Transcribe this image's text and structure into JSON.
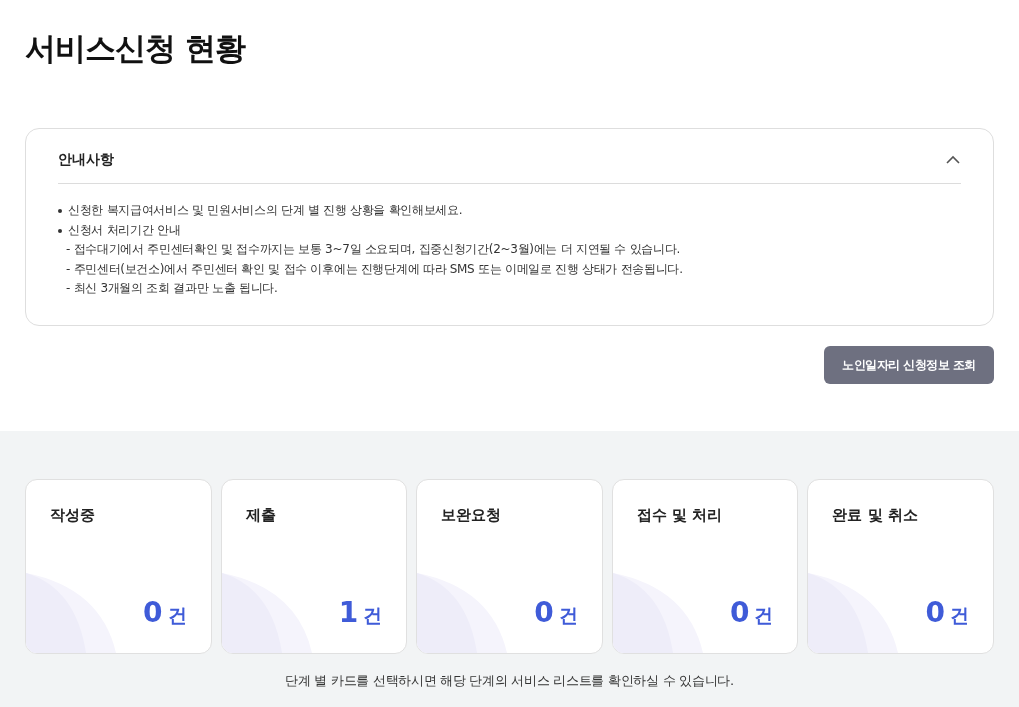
{
  "page_title": "서비스신청 현황",
  "notice": {
    "title": "안내사항",
    "expanded": true,
    "items": [
      {
        "text": "신청한 복지급여서비스 및 민원서비스의 단계 별 진행 상황을 확인해보세요."
      },
      {
        "text": "신청서 처리기간 안내",
        "children": [
          "- 접수대기에서 주민센터확인 및 접수까지는 보통 3~7일 소요되며, 집중신청기간(2~3월)에는 더 지연될 수 있습니다.",
          "- 주민센터(보건소)에서 주민센터 확인 및 접수 이후에는 진행단계에 따라 SMS 또는 이메일로 진행 상태가 전송됩니다.",
          "- 최신 3개월의 조회 결과만 노출 됩니다."
        ]
      }
    ]
  },
  "action_button": "노인일자리 신청정보 조회",
  "stage_cards": [
    {
      "label": "작성중",
      "count": "0",
      "unit": "건"
    },
    {
      "label": "제출",
      "count": "1",
      "unit": "건"
    },
    {
      "label": "보완요청",
      "count": "0",
      "unit": "건"
    },
    {
      "label": "접수 및 처리",
      "count": "0",
      "unit": "건"
    },
    {
      "label": "완료 및 취소",
      "count": "0",
      "unit": "건"
    }
  ],
  "footer_note": "단계 별 카드를 선택하시면 해당 단계의 서비스 리스트를 확인하실 수 있습니다."
}
